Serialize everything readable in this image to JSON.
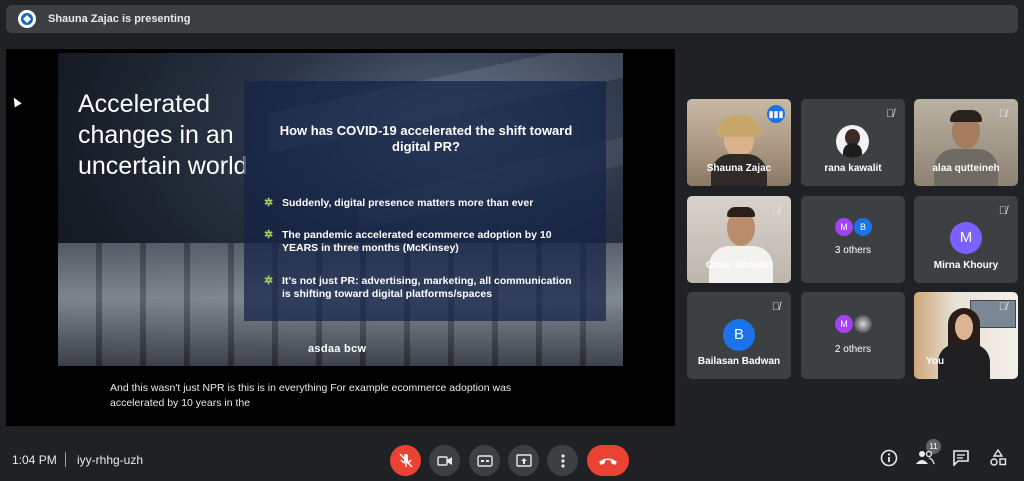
{
  "top_bar": {
    "presenting_text": "Shauna Zajac is presenting"
  },
  "slide": {
    "title": "Accelerated changes in an uncertain world",
    "question": "How has COVID-19 accelerated the shift toward digital PR?",
    "bullets": [
      "Suddenly, digital presence matters more than ever",
      "The pandemic accelerated ecommerce adoption by 10 YEARS in three months (McKinsey)",
      "It’s not just PR: advertising, marketing, all communication is shifting toward digital platforms/spaces"
    ],
    "brand": "asdaa bcw"
  },
  "caption": "And this wasn't just NPR is this is in everything For example ecommerce adoption was accelerated by 10 years in the",
  "participants": [
    {
      "name": "Shauna Zajac",
      "kind": "photo",
      "speaking": true
    },
    {
      "name": "rana kawalit",
      "kind": "photo",
      "muted": true
    },
    {
      "name": "alaa qutteineh",
      "kind": "photo",
      "muted": true
    },
    {
      "name": "Omar Obeidat",
      "kind": "photo",
      "muted": true
    },
    {
      "name": "3 others",
      "kind": "group",
      "avatars": [
        "M",
        "B"
      ],
      "avatar_colors": [
        "#a142f4",
        "#1a73e8"
      ]
    },
    {
      "name": "Mirna Khoury",
      "kind": "avatar",
      "initial": "M",
      "color": "#7b61ff",
      "muted": true
    },
    {
      "name": "Bailasan Badwan",
      "kind": "avatar",
      "initial": "B",
      "color": "#1a73e8",
      "muted": true
    },
    {
      "name": "2 others",
      "kind": "group",
      "avatars": [
        "M",
        ""
      ],
      "avatar_colors": [
        "#a142f4",
        "#5f6368"
      ]
    },
    {
      "name": "You",
      "kind": "photo",
      "muted": true
    }
  ],
  "meeting": {
    "time": "1:04 PM",
    "code": "iyy-rhhg-uzh",
    "participant_count": "11"
  },
  "colors": {
    "accent": "#8ab4f8",
    "end_call": "#ea4335",
    "tile_bg": "#3c4043"
  }
}
